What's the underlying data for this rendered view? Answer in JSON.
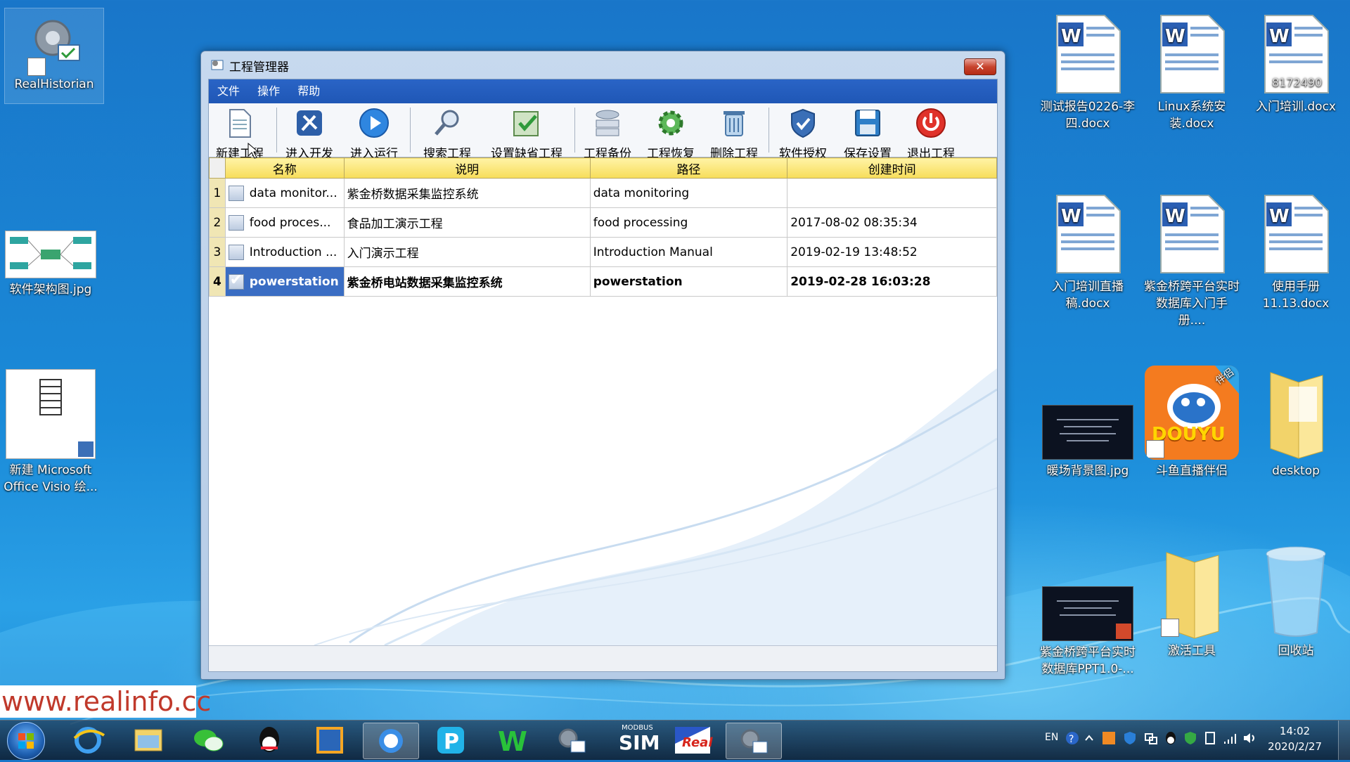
{
  "desktop": {
    "left_icons": [
      {
        "label": "RealHistorian"
      },
      {
        "label": "软件架构图.jpg"
      },
      {
        "label": "新建 Microsoft Office Visio 绘..."
      }
    ],
    "right_icons": [
      {
        "label": "测试报告0226-李四.docx"
      },
      {
        "label": "Linux系统安装.docx"
      },
      {
        "label": "入门培训.docx"
      },
      {
        "label": "入门培训直播稿.docx"
      },
      {
        "label": "紫金桥跨平台实时数据库入门手册...."
      },
      {
        "label": "使用手册11.13.docx"
      },
      {
        "label": "暖场背景图.jpg"
      },
      {
        "label": "斗鱼直播伴侣"
      },
      {
        "label": "desktop"
      },
      {
        "label": "紫金桥跨平台实时数据库PPT1.0-..."
      },
      {
        "label": "激活工具"
      },
      {
        "label": "回收站"
      }
    ],
    "douyu_badge": "伴侣",
    "douyu_logo": "DOUYU",
    "doc_overlay_text": "8172490"
  },
  "window": {
    "title": "工程管理器",
    "close_symbol": "✕",
    "menu": [
      "文件",
      "操作",
      "帮助"
    ],
    "toolbar": [
      {
        "label": "新建工程",
        "icon": "new-document-icon"
      },
      {
        "label": "进入开发",
        "icon": "tools-icon"
      },
      {
        "label": "进入运行",
        "icon": "play-icon"
      },
      {
        "label": "搜索工程",
        "icon": "search-icon"
      },
      {
        "label": "设置缺省工程",
        "icon": "check-folder-icon"
      },
      {
        "label": "工程备份",
        "icon": "backup-icon"
      },
      {
        "label": "工程恢复",
        "icon": "restore-gear-icon"
      },
      {
        "label": "删除工程",
        "icon": "trash-icon"
      },
      {
        "label": "软件授权",
        "icon": "shield-icon"
      },
      {
        "label": "保存设置",
        "icon": "save-icon"
      },
      {
        "label": "退出工程",
        "icon": "power-icon"
      }
    ],
    "table": {
      "headers": [
        "名称",
        "说明",
        "路径",
        "创建时间"
      ],
      "rows": [
        {
          "num": "1",
          "name": "data monitor...",
          "desc": "紫金桥数据采集监控系统",
          "path": "data monitoring",
          "time": "",
          "checked": false
        },
        {
          "num": "2",
          "name": "food proces...",
          "desc": "食品加工演示工程",
          "path": "food processing",
          "time": "2017-08-02 08:35:34",
          "checked": false
        },
        {
          "num": "3",
          "name": "Introduction ...",
          "desc": "入门演示工程",
          "path": "Introduction Manual",
          "time": "2019-02-19 13:48:52",
          "checked": false
        },
        {
          "num": "4",
          "name": "powerstation",
          "desc": "紫金桥电站数据采集监控系统",
          "path": "powerstation",
          "time": "2019-02-28 16:03:28",
          "checked": true
        }
      ]
    }
  },
  "watermark": "www.realinfo.cc",
  "taskbar": {
    "items": [
      "internet-explorer-icon",
      "file-explorer-icon",
      "wechat-icon",
      "qq-icon",
      "virtualbox-icon",
      "browser-icon",
      "pp-app-icon",
      "wps-icon",
      "project-manager-icon",
      "modbus-sim-icon",
      "realinfo-icon",
      "project-manager-active-icon"
    ],
    "sim_top": "MODBUS",
    "sim_text": "SIM",
    "real_text": "Real",
    "lang": "EN",
    "time": "14:02",
    "date": "2020/2/27"
  }
}
